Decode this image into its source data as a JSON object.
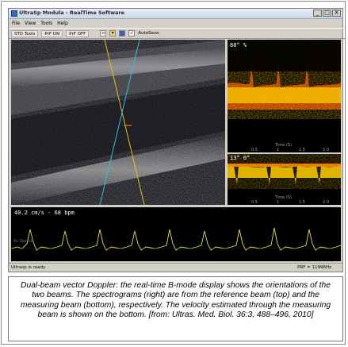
{
  "window": {
    "title": "UltraSp Modula - RealTime Software",
    "buttons": [
      "_",
      "□",
      "X"
    ]
  },
  "menu": [
    "File",
    "View",
    "Tools",
    "Help"
  ],
  "toolbar": {
    "std_tools": "STD Tools",
    "prf_on": "PrF ON",
    "prf_off": "PrF OFF",
    "autosave": "AutoSave"
  },
  "spectrogram_top": {
    "label": "88° %",
    "time_label": "Time (S)",
    "ticks": [
      "0.5",
      "1",
      "1.5",
      "2.0"
    ]
  },
  "spectrogram_bottom": {
    "label": "13° 0°",
    "time_label": "Time (S)",
    "ticks": [
      "0.5",
      "1",
      "1.5",
      "2.0"
    ]
  },
  "velocity": {
    "readout": "40.2 cm/s - 68 bpm",
    "axis_label": "Av Speed"
  },
  "status": {
    "left": "Ultrasp is ready",
    "right": "PRF = 11996Hz"
  },
  "caption": "Dual-beam vector Doppler: the real-time B-mode display shows the orientations of the two beams. The spectrograms (right) are from the reference beam (top)  and the measuring beam (bottom), respectively. The velocity estimated through the measuring beam is shown on the bottom. [from: Ultras. Med. Biol. 36:3, 488–496, 2010]",
  "colors": {
    "reference_beam": "#e0c020",
    "measuring_beam": "#30c0e0",
    "velocity_trace": "#e8e040",
    "spectrum_hot": "#ffd000"
  }
}
